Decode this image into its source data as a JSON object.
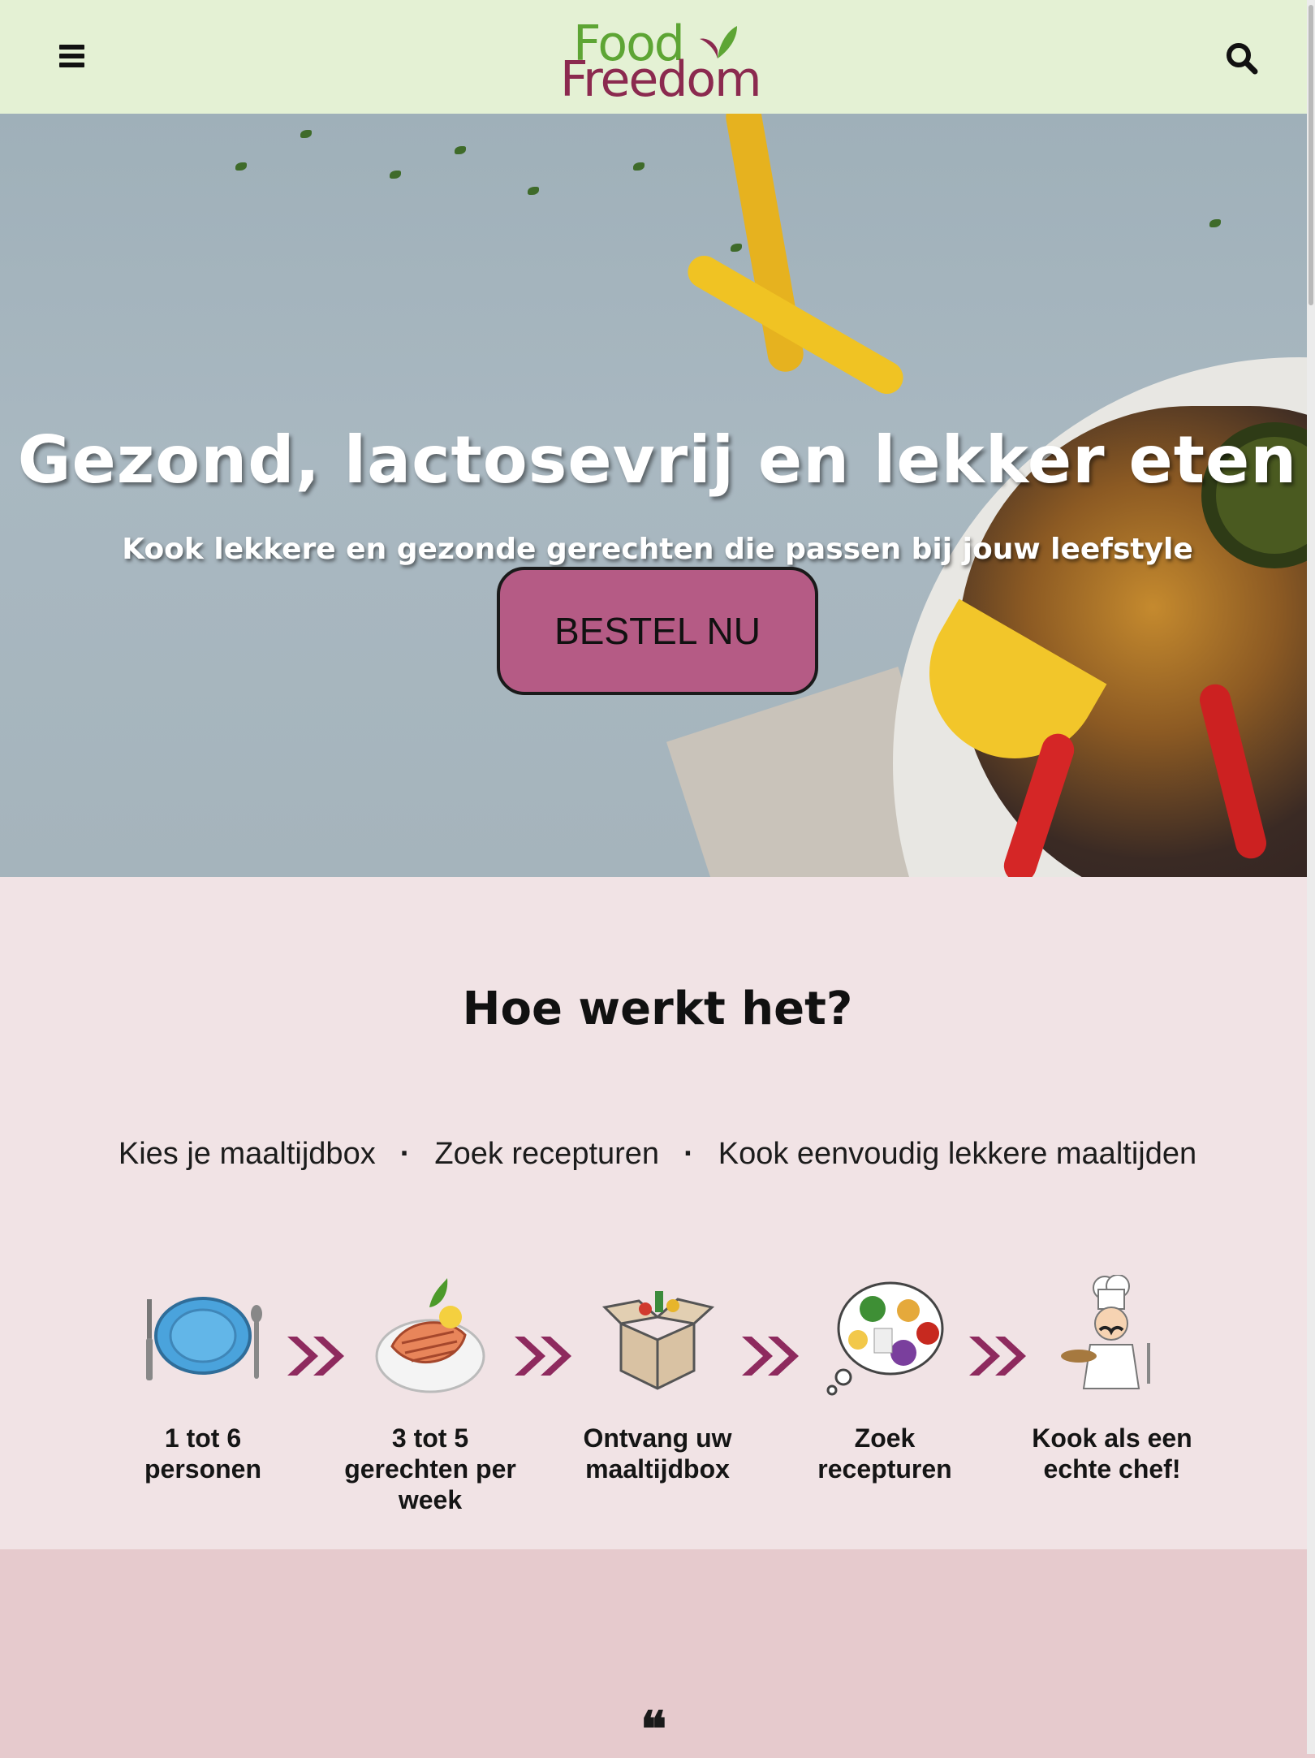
{
  "header": {
    "logo_line1": "Food",
    "logo_line2": "Freedom",
    "colors": {
      "bg": "#e4f1d4",
      "logo_green": "#5da534",
      "logo_plum": "#8b2a4f"
    },
    "icons": [
      "menu-icon",
      "search-icon"
    ]
  },
  "hero": {
    "title": "Gezond, lactosevrij en lekker eten",
    "subtitle": "Kook lekkere en gezonde gerechten die passen bij jouw leefstyle",
    "cta_label": "BESTEL NU",
    "colors": {
      "cta": "#b55b85"
    }
  },
  "how": {
    "title": "Hoe werkt het?",
    "summary": [
      "Kies je maaltijdbox",
      "Zoek recepturen",
      "Kook eenvoudig lekkere maaltijden"
    ],
    "separator": "·",
    "steps": [
      {
        "icon": "plate-cutlery-icon",
        "label": "1 tot 6 personen"
      },
      {
        "icon": "salmon-dish-icon",
        "label": "3 tot 5 gerechten per week"
      },
      {
        "icon": "grocery-box-icon",
        "label": "Ontvang uw maaltijdbox"
      },
      {
        "icon": "food-thought-icon",
        "label": "Zoek recepturen"
      },
      {
        "icon": "chef-icon",
        "label": "Kook als een echte chef!"
      }
    ],
    "colors": {
      "bg": "#f1e3e5",
      "arrow": "#8e2a5e"
    }
  },
  "testimonial": {
    "quote_icon": "quote-icon",
    "quote_mark": "❝",
    "colors": {
      "bg": "#e6cacd"
    }
  }
}
